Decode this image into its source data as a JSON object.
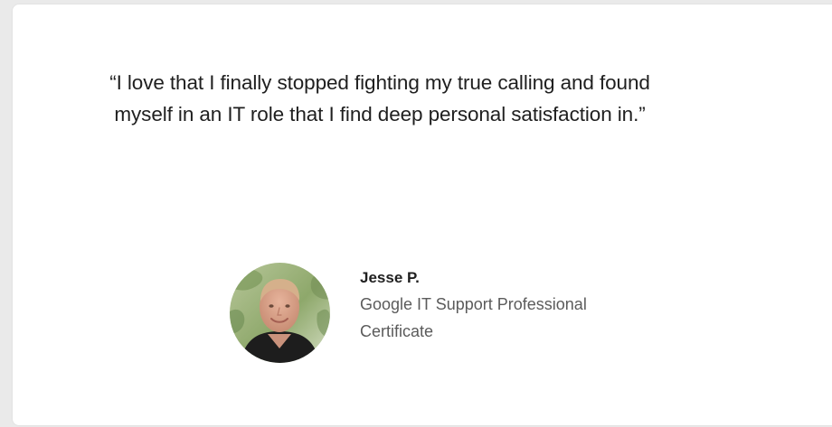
{
  "testimonial": {
    "quote": "“I love that I finally stopped fighting my true calling and found myself in an IT role that I find deep personal satisfaction in.”",
    "author_name": "Jesse P.",
    "program": "Google IT Support Professional Certificate",
    "avatar_icon": "person-photo"
  },
  "colors": {
    "background": "#eaeaea",
    "card": "#ffffff",
    "quote_text": "#1f1f1f",
    "name_text": "#1f1f1f",
    "program_text": "#5b5b5b"
  }
}
